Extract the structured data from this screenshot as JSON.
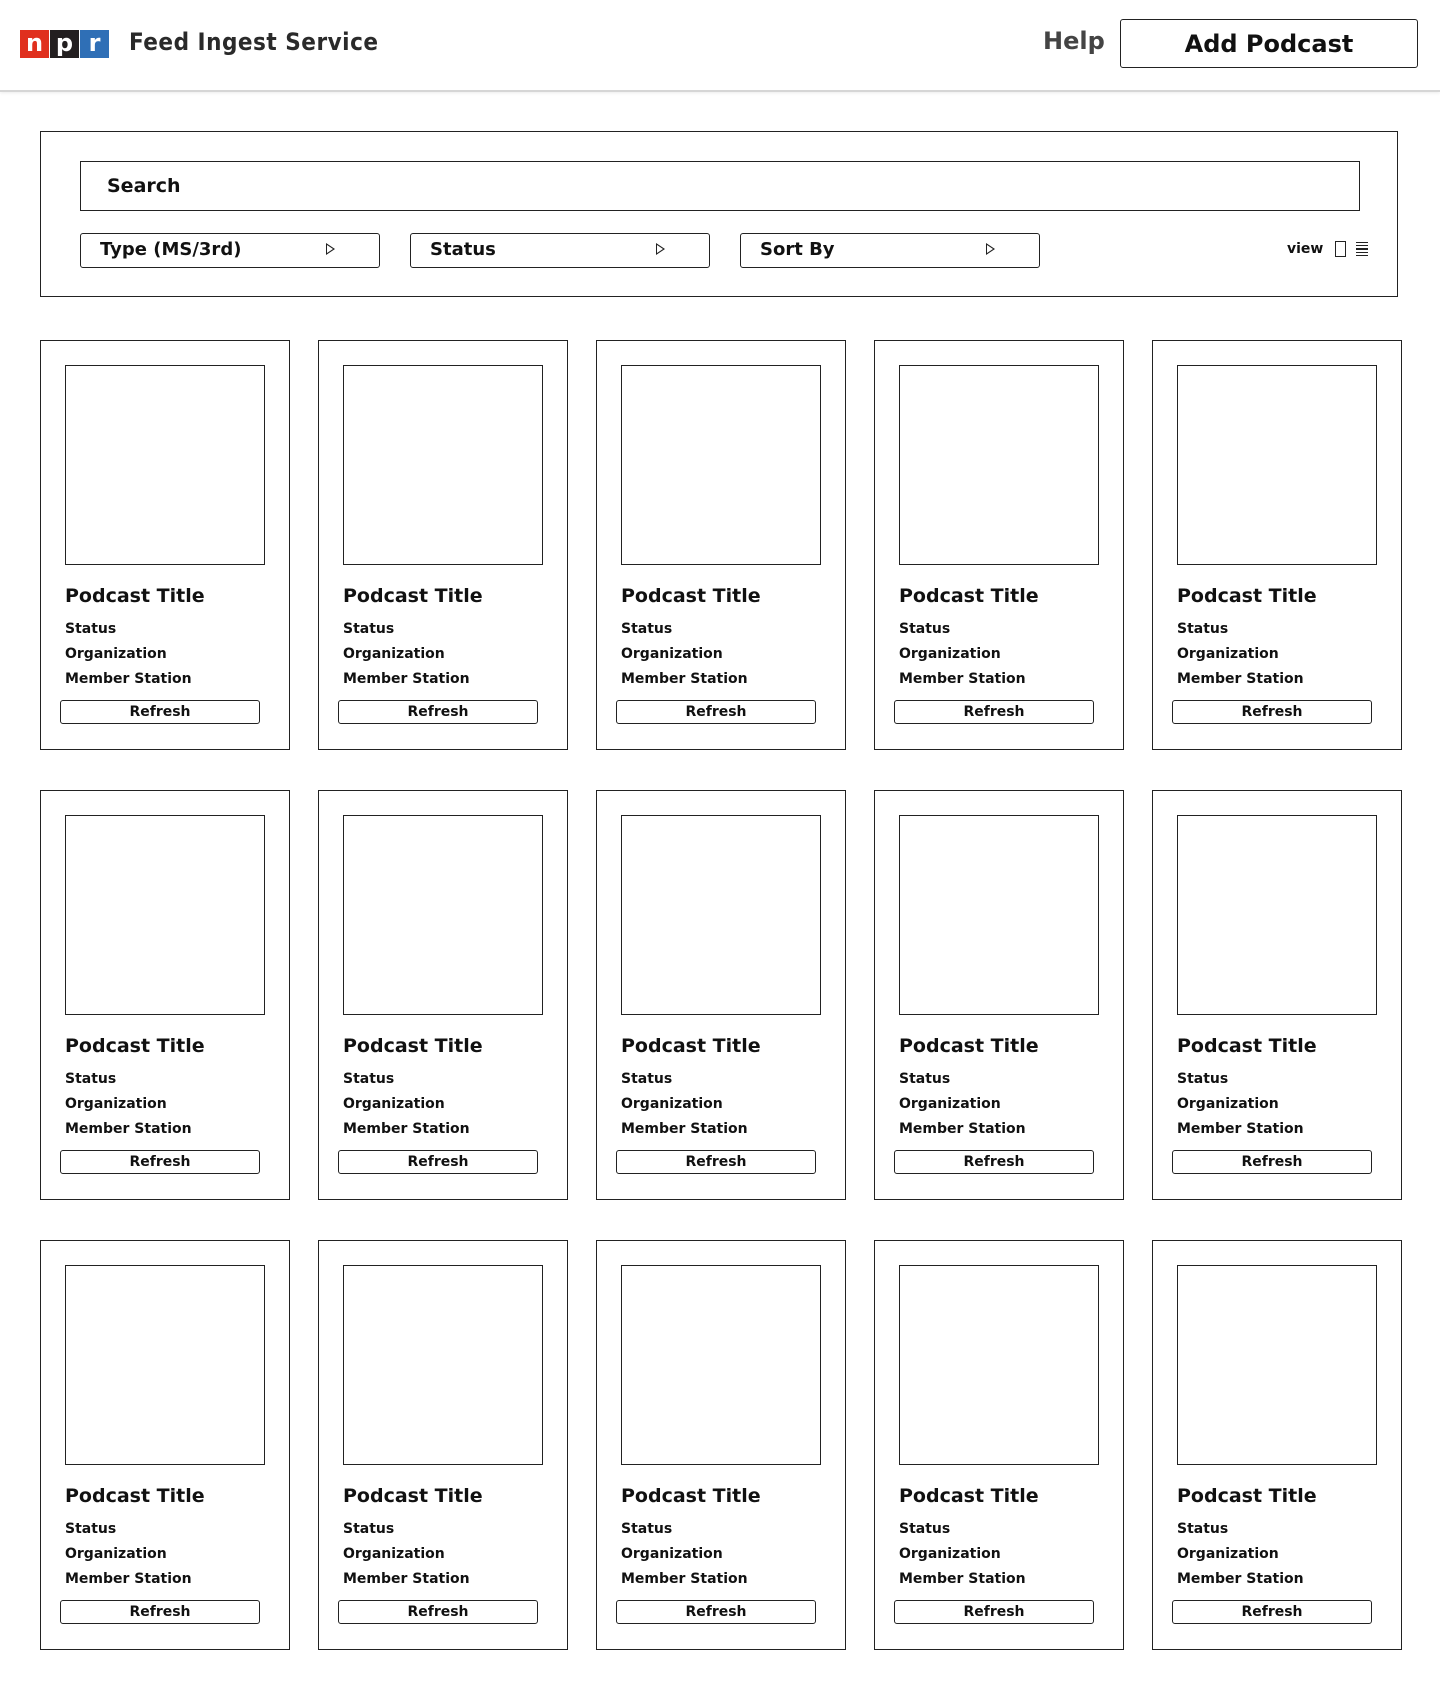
{
  "header": {
    "logo": {
      "letters": [
        {
          "char": "n",
          "color": "#e0301e"
        },
        {
          "char": "p",
          "color": "#231f20"
        },
        {
          "char": "r",
          "color": "#2f6fb6"
        }
      ]
    },
    "app_title": "Feed Ingest Service",
    "help_label": "Help",
    "add_button_label": "Add Podcast"
  },
  "filters": {
    "search_placeholder": "Search",
    "type_select": "Type (MS/3rd)",
    "status_select": "Status",
    "sort_select": "Sort By",
    "view_label": "view",
    "view_icons": [
      "grid-view-icon",
      "list-view-icon"
    ]
  },
  "podcasts": [
    {
      "title": "Podcast Title",
      "status": "Status",
      "organization": "Organization",
      "member_station": "Member Station",
      "action": "Refresh"
    },
    {
      "title": "Podcast Title",
      "status": "Status",
      "organization": "Organization",
      "member_station": "Member Station",
      "action": "Refresh"
    },
    {
      "title": "Podcast Title",
      "status": "Status",
      "organization": "Organization",
      "member_station": "Member Station",
      "action": "Refresh"
    },
    {
      "title": "Podcast Title",
      "status": "Status",
      "organization": "Organization",
      "member_station": "Member Station",
      "action": "Refresh"
    },
    {
      "title": "Podcast Title",
      "status": "Status",
      "organization": "Organization",
      "member_station": "Member Station",
      "action": "Refresh"
    },
    {
      "title": "Podcast Title",
      "status": "Status",
      "organization": "Organization",
      "member_station": "Member Station",
      "action": "Refresh"
    },
    {
      "title": "Podcast Title",
      "status": "Status",
      "organization": "Organization",
      "member_station": "Member Station",
      "action": "Refresh"
    },
    {
      "title": "Podcast Title",
      "status": "Status",
      "organization": "Organization",
      "member_station": "Member Station",
      "action": "Refresh"
    },
    {
      "title": "Podcast Title",
      "status": "Status",
      "organization": "Organization",
      "member_station": "Member Station",
      "action": "Refresh"
    },
    {
      "title": "Podcast Title",
      "status": "Status",
      "organization": "Organization",
      "member_station": "Member Station",
      "action": "Refresh"
    },
    {
      "title": "Podcast Title",
      "status": "Status",
      "organization": "Organization",
      "member_station": "Member Station",
      "action": "Refresh"
    },
    {
      "title": "Podcast Title",
      "status": "Status",
      "organization": "Organization",
      "member_station": "Member Station",
      "action": "Refresh"
    },
    {
      "title": "Podcast Title",
      "status": "Status",
      "organization": "Organization",
      "member_station": "Member Station",
      "action": "Refresh"
    },
    {
      "title": "Podcast Title",
      "status": "Status",
      "organization": "Organization",
      "member_station": "Member Station",
      "action": "Refresh"
    },
    {
      "title": "Podcast Title",
      "status": "Status",
      "organization": "Organization",
      "member_station": "Member Station",
      "action": "Refresh"
    }
  ]
}
